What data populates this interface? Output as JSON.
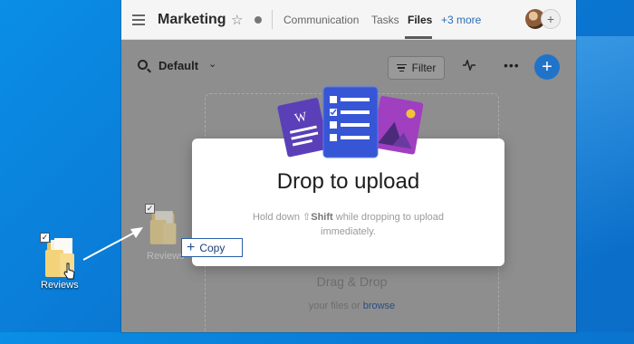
{
  "window": {
    "title": "Marketing",
    "tabs": [
      "Communication",
      "Tasks",
      "Files"
    ],
    "active_tab": "Files",
    "more_tabs": "+3 more"
  },
  "toolbar": {
    "view_label": "Default",
    "filter_label": "Filter"
  },
  "dropzone": {
    "title": "Drag & Drop",
    "subtitle_prefix": "your files or",
    "browse_link": "browse"
  },
  "modal": {
    "title": "Drop to upload",
    "hint_prefix": "Hold down",
    "hint_key": "Shift",
    "hint_suffix": "while dropping to upload immediately."
  },
  "desktop": {
    "folder_label": "Reviews",
    "ghost_label": "Reviews",
    "copy_tooltip": "Copy",
    "check_glyph": "✓"
  },
  "colors": {
    "accent": "#1f74c9",
    "desktop_blue": "#0a79d4"
  },
  "icons": [
    "hamburger-icon",
    "star-icon",
    "search-icon",
    "chevron-down-icon",
    "filter-icon",
    "activity-icon",
    "more-icon",
    "plus-icon",
    "folder-icon",
    "cursor-icon"
  ]
}
